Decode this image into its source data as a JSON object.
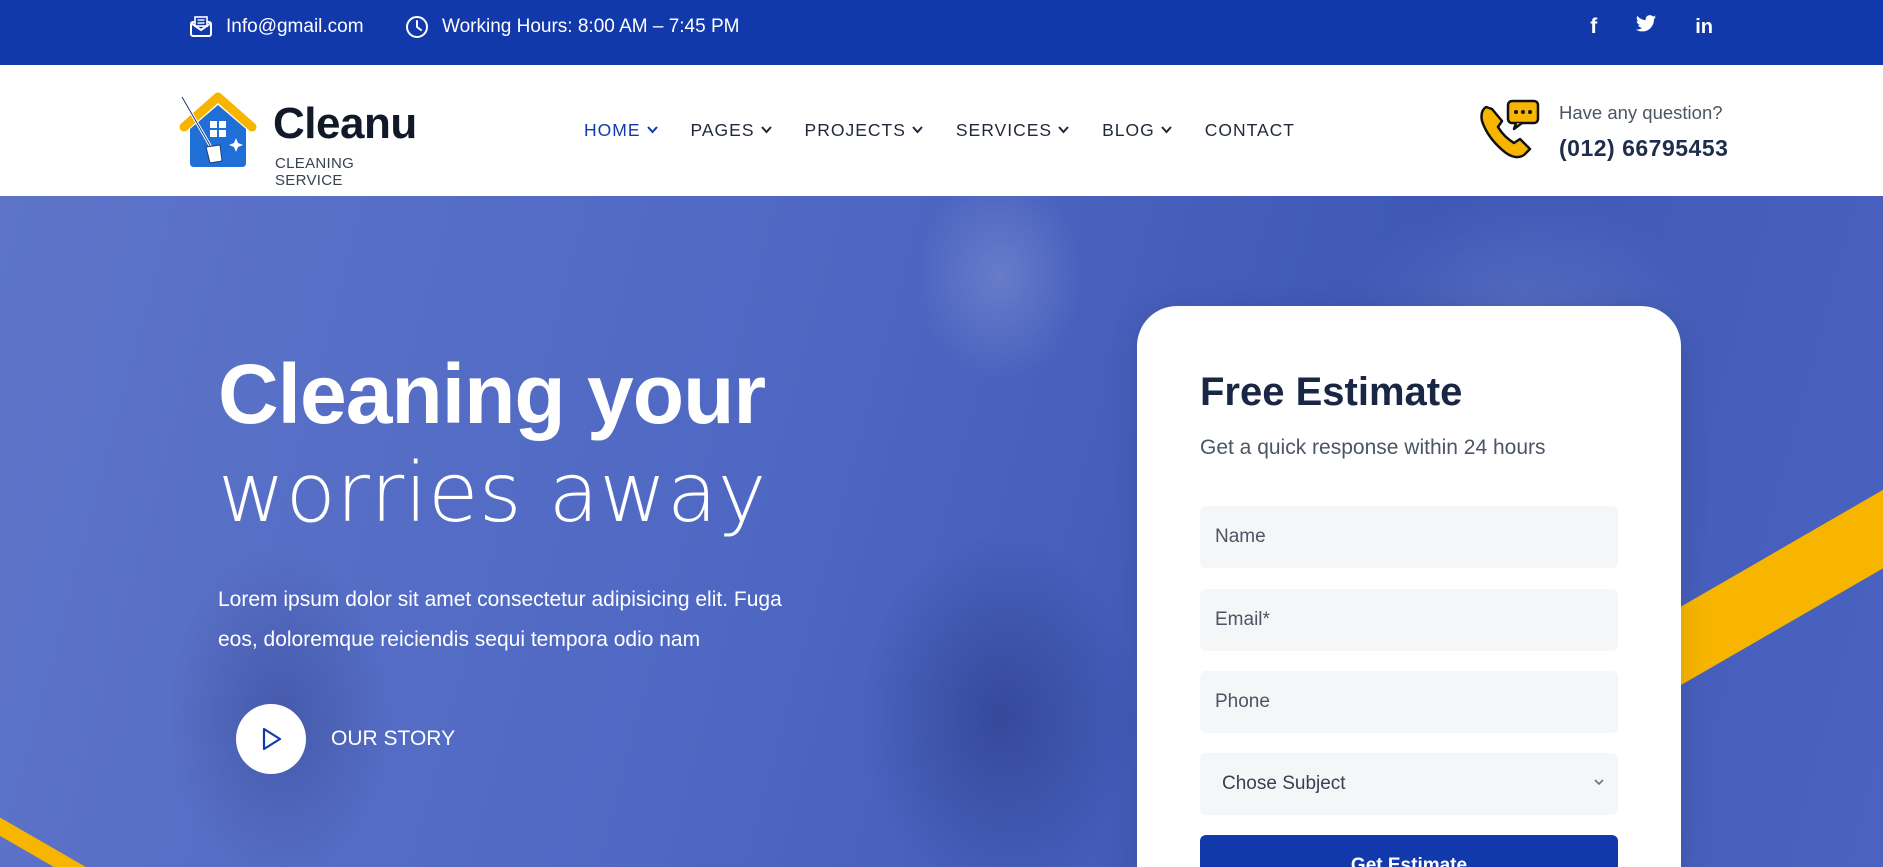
{
  "topbar": {
    "email": "Info@gmail.com",
    "hours": "Working Hours: 8:00 AM – 7:45 PM",
    "social_icons": [
      "facebook-icon",
      "twitter-icon",
      "linkedin-icon"
    ],
    "social_glyphs": {
      "facebook": "f",
      "twitter": "t",
      "linkedin": "in"
    }
  },
  "brand": {
    "name": "Cleanu",
    "tagline": "CLEANING SERVICE"
  },
  "nav": {
    "items": [
      {
        "label": "HOME",
        "active": true,
        "has_dropdown": true
      },
      {
        "label": "PAGES",
        "active": false,
        "has_dropdown": true
      },
      {
        "label": "PROJECTS",
        "active": false,
        "has_dropdown": true
      },
      {
        "label": "SERVICES",
        "active": false,
        "has_dropdown": true
      },
      {
        "label": "BLOG",
        "active": false,
        "has_dropdown": true
      },
      {
        "label": "CONTACT",
        "active": false,
        "has_dropdown": false
      }
    ]
  },
  "contact": {
    "question": "Have any question?",
    "phone": "(012) 66795453"
  },
  "hero": {
    "title_bold": "Cleaning your",
    "title_light": "worries away",
    "lead": "Lorem ipsum dolor sit amet consectetur adipisicing elit. Fuga eos, doloremque reiciendis sequi tempora odio nam",
    "story_label": "OUR STORY"
  },
  "estimate": {
    "title": "Free Estimate",
    "subtitle": "Get a quick response within 24 hours",
    "name_placeholder": "Name",
    "email_placeholder": "Email*",
    "phone_placeholder": "Phone",
    "subject_selected": "Chose Subject",
    "button_label": "Get Estimate"
  },
  "colors": {
    "primary": "#1239ab",
    "accent": "#f7b500",
    "heading": "#1a2744"
  }
}
